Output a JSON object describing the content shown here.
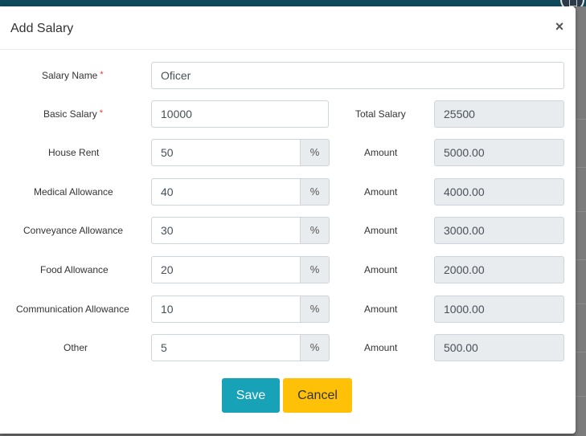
{
  "modal": {
    "title": "Add Salary",
    "close_glyph": "×"
  },
  "form": {
    "required_marker": "*",
    "salary_name": {
      "label": "Salary Name",
      "value": "Oficer"
    },
    "basic_salary": {
      "label": "Basic Salary",
      "value": "10000"
    },
    "total_salary": {
      "label": "Total Salary",
      "value": "25500"
    },
    "percent_symbol": "%",
    "allowances": [
      {
        "label": "House Rent",
        "percent": "50",
        "amount_label": "Amount",
        "amount": "5000.00"
      },
      {
        "label": "Medical Allowance",
        "percent": "40",
        "amount_label": "Amount",
        "amount": "4000.00"
      },
      {
        "label": "Conveyance Allowance",
        "percent": "30",
        "amount_label": "Amount",
        "amount": "3000.00"
      },
      {
        "label": "Food Allowance",
        "percent": "20",
        "amount_label": "Amount",
        "amount": "2000.00"
      },
      {
        "label": "Communication Allowance",
        "percent": "10",
        "amount_label": "Amount",
        "amount": "1000.00"
      },
      {
        "label": "Other",
        "percent": "5",
        "amount_label": "Amount",
        "amount": "500.00"
      }
    ]
  },
  "actions": {
    "save_label": "Save",
    "cancel_label": "Cancel"
  },
  "colors": {
    "save": "#17a2b8",
    "cancel": "#ffc107",
    "required": "#e53935"
  }
}
